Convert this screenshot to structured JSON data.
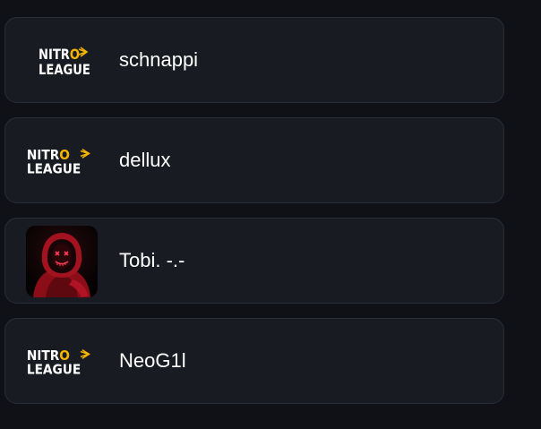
{
  "players": [
    {
      "name": "schnappi",
      "avatar": "nitro-league-logo"
    },
    {
      "name": "dellux",
      "avatar": "nitro-league-logo"
    },
    {
      "name": "Tobi. -.-",
      "avatar": "masked-hoodie-photo"
    },
    {
      "name": "NeoG1l",
      "avatar": "nitro-league-logo"
    }
  ],
  "logo": {
    "line1_a": "NITR",
    "line1_b": "O",
    "line2": "LEAGUE",
    "text_color": "#ffffff",
    "accent_color": "#f5b400"
  },
  "colors": {
    "background": "#0f1116",
    "card": "#181b21",
    "card_border": "#2a2e36",
    "text": "#ffffff"
  }
}
